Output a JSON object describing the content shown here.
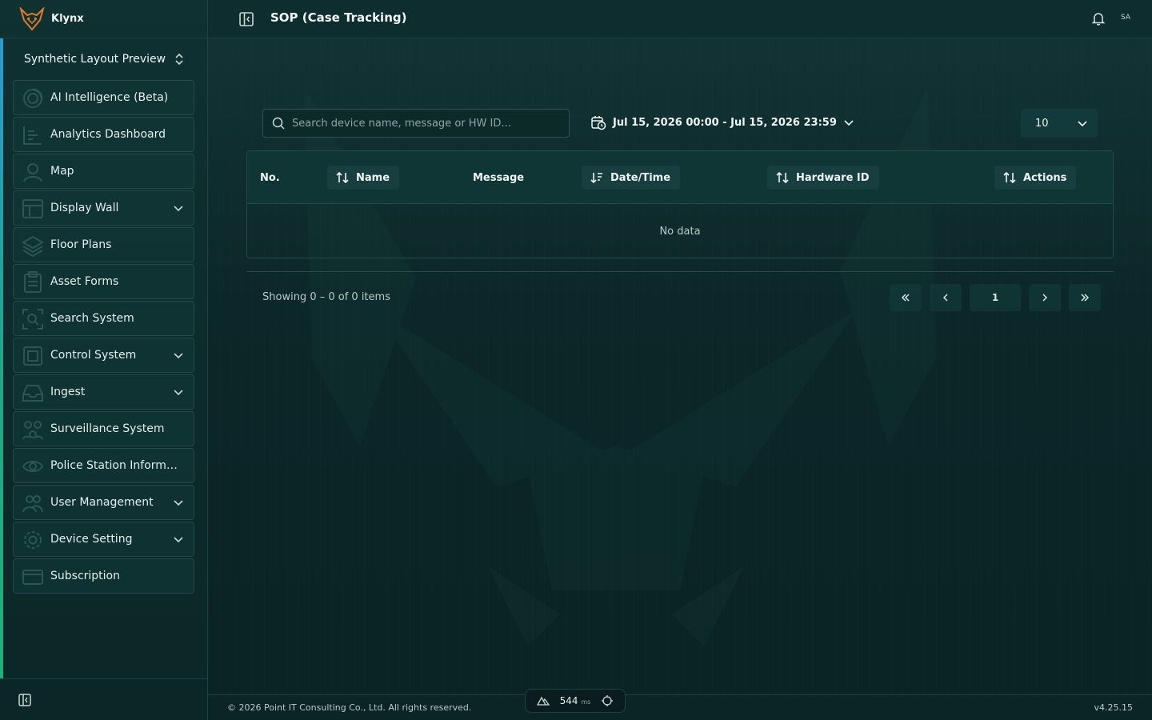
{
  "app": {
    "brand": "Klynx"
  },
  "workspace": {
    "label": "Synthetic Layout Preview"
  },
  "sidebar": {
    "items": [
      {
        "label": "AI Intelligence (Beta)",
        "icon": "ai-icon",
        "has_chevron": false
      },
      {
        "label": "Analytics Dashboard",
        "icon": "chart-icon",
        "has_chevron": false
      },
      {
        "label": "Map",
        "icon": "user-map-icon",
        "has_chevron": false
      },
      {
        "label": "Display Wall",
        "icon": "layout-icon",
        "has_chevron": true
      },
      {
        "label": "Floor Plans",
        "icon": "layers-icon",
        "has_chevron": false
      },
      {
        "label": "Asset Forms",
        "icon": "clipboard-icon",
        "has_chevron": false
      },
      {
        "label": "Search System",
        "icon": "scan-icon",
        "has_chevron": false
      },
      {
        "label": "Control System",
        "icon": "control-icon",
        "has_chevron": true
      },
      {
        "label": "Ingest",
        "icon": "inbox-icon",
        "has_chevron": true
      },
      {
        "label": "Surveillance System",
        "icon": "network-icon",
        "has_chevron": false
      },
      {
        "label": "Police Station Informati...",
        "icon": "eye-icon",
        "has_chevron": false
      },
      {
        "label": "User Management",
        "icon": "users-icon",
        "has_chevron": true
      },
      {
        "label": "Device Setting",
        "icon": "gear-icon",
        "has_chevron": true
      },
      {
        "label": "Subscription",
        "icon": "card-icon",
        "has_chevron": false
      }
    ]
  },
  "header": {
    "title": "SOP (Case Tracking)",
    "avatar_initials": "SA"
  },
  "filters": {
    "search_placeholder": "Search device name, message or HW ID...",
    "date_range": "Jul 15, 2026 00:00 - Jul 15, 2026 23:59",
    "page_size": "10"
  },
  "table": {
    "columns": {
      "no": "No.",
      "name": "Name",
      "message": "Message",
      "datetime": "Date/Time",
      "hardware_id": "Hardware ID",
      "actions": "Actions"
    },
    "empty_text": "No data"
  },
  "pagination": {
    "showing": "Showing 0 – 0 of 0 items",
    "current_page": "1"
  },
  "footer": {
    "copyright": "© 2026 Point IT Consulting Co., Ltd. All rights reserved.",
    "version": "v4.25.15",
    "latency_value": "544",
    "latency_unit": "ms"
  },
  "colors": {
    "background": "#0b2527",
    "sidebar_accent_top": "#2a9bd0",
    "sidebar_accent_bottom": "#1fb07a",
    "brand_orange": "#e07a2c"
  }
}
